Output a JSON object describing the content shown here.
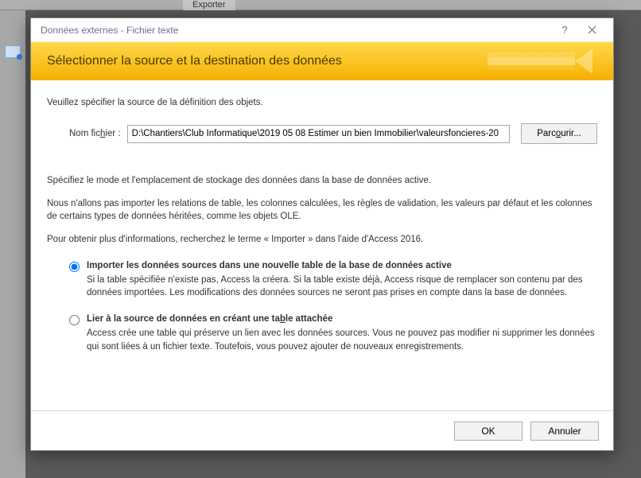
{
  "bgTab": "Exporter",
  "titlebar": {
    "title": "Données externes - Fichier texte",
    "help": "?",
    "close": "×"
  },
  "banner": {
    "title": "Sélectionner la source et la destination des données"
  },
  "content": {
    "instr1": "Veuillez spécifier la source de la définition des objets.",
    "file_label_prefix": "Nom fic",
    "file_label_underline": "h",
    "file_label_suffix": "ier :",
    "file_value": "D:\\Chantiers\\Club Informatique\\2019 05 08 Estimer un bien Immobilier\\valeursfoncieres-20",
    "browse_prefix": "Parc",
    "browse_underline": "o",
    "browse_suffix": "urir...",
    "para1": "Spécifiez le mode et l'emplacement de stockage des données dans la base de données active.",
    "para2": "Nous n'allons pas importer les relations de table, les colonnes calculées, les règles de validation, les valeurs par défaut et les colonnes de certains types de données héritées, comme les objets OLE.",
    "para3": "Pour obtenir plus d'informations, recherchez le terme « Importer » dans l'aide d'Access 2016."
  },
  "options": {
    "opt1": {
      "title": "Importer les données sources dans une nouvelle table de la base de données active",
      "desc": "Si la table spécifiée n'existe pas, Access la créera. Si la table existe déjà, Access risque de remplacer son contenu par des données importées. Les modifications des données sources ne seront pas prises en compte dans la base de données.",
      "checked": true
    },
    "opt2": {
      "title_prefix": "Lier à la source de données en créant une ta",
      "title_underline": "b",
      "title_suffix": "le attachée",
      "desc": "Access crée une table qui préserve un lien avec les données sources. Vous ne pouvez pas modifier ni supprimer les données qui sont liées à un fichier texte. Toutefois, vous pouvez ajouter de nouveaux enregistrements.",
      "checked": false
    }
  },
  "footer": {
    "ok": "OK",
    "cancel": "Annuler"
  }
}
